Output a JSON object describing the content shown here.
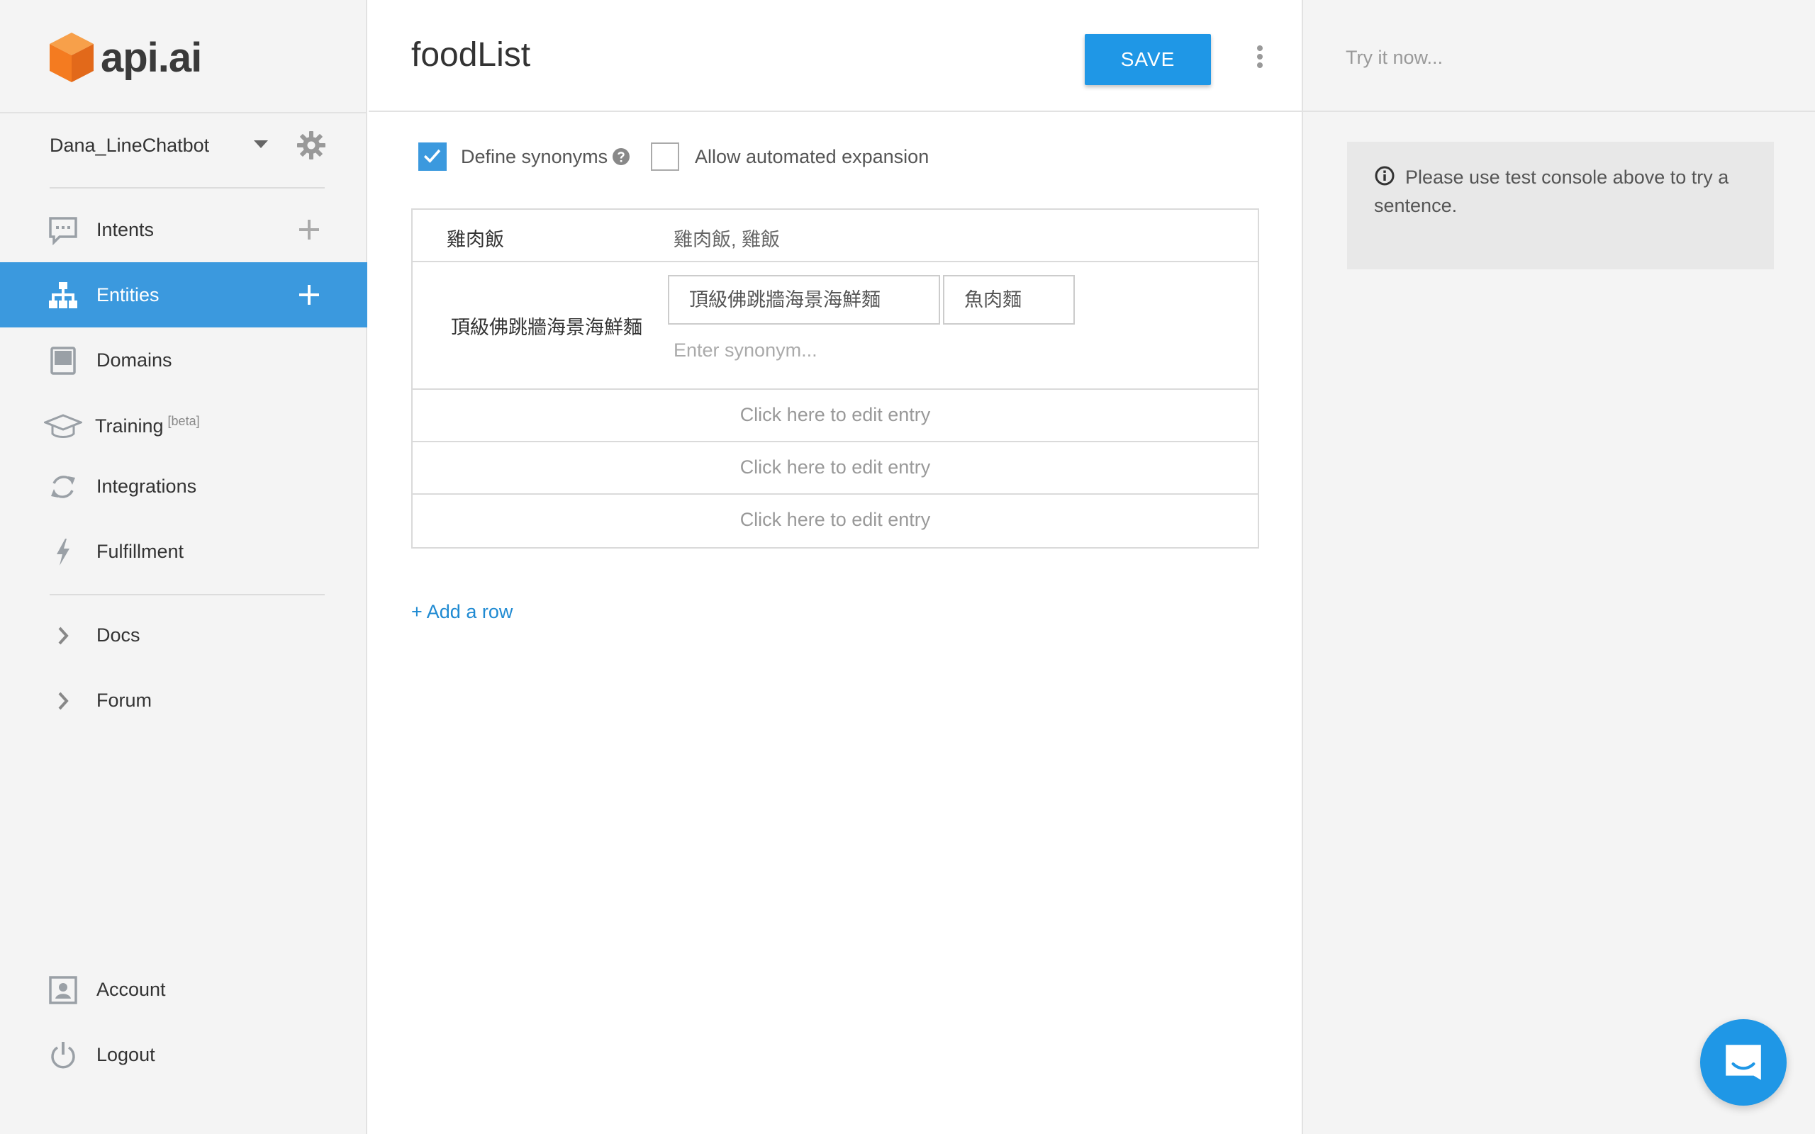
{
  "brand": {
    "logo_text": "api.ai",
    "accent": "#3b99de",
    "logo_orange": "#f47b20"
  },
  "sidebar": {
    "agent_name": "Dana_LineChatbot",
    "nav": [
      {
        "label": "Intents",
        "icon": "chat-icon",
        "has_add": true,
        "active": false
      },
      {
        "label": "Entities",
        "icon": "sitemap-icon",
        "has_add": true,
        "active": true
      },
      {
        "label": "Domains",
        "icon": "book-icon",
        "has_add": false,
        "active": false
      },
      {
        "label": "Training",
        "badge": "[beta]",
        "icon": "graduation-cap-icon",
        "has_add": false,
        "active": false
      },
      {
        "label": "Integrations",
        "icon": "sync-icon",
        "has_add": false,
        "active": false
      },
      {
        "label": "Fulfillment",
        "icon": "bolt-icon",
        "has_add": false,
        "active": false
      }
    ],
    "links": [
      {
        "label": "Docs",
        "icon": "chevron-right-icon"
      },
      {
        "label": "Forum",
        "icon": "chevron-right-icon"
      }
    ],
    "bottom": [
      {
        "label": "Account",
        "icon": "account-icon"
      },
      {
        "label": "Logout",
        "icon": "power-icon"
      }
    ]
  },
  "header": {
    "title": "foodList",
    "save_label": "SAVE"
  },
  "options": {
    "define_synonyms": {
      "label": "Define synonyms",
      "checked": true
    },
    "allow_expansion": {
      "label": "Allow automated expansion",
      "checked": false
    }
  },
  "entries": {
    "row1": {
      "reference": "雞肉飯",
      "synonyms": "雞肉飯, 雞飯"
    },
    "row2": {
      "reference": "頂級佛跳牆海景海鮮麵",
      "chips": [
        "頂級佛跳牆海景海鮮麵",
        "魚肉麵"
      ],
      "placeholder": "Enter synonym..."
    },
    "empty_rows": [
      "Click here to edit entry",
      "Click here to edit entry",
      "Click here to edit entry"
    ]
  },
  "add_row_label": "+ Add a row",
  "right_panel": {
    "try_placeholder": "Try it now...",
    "info_text": "Please use test console above to try a sentence."
  }
}
